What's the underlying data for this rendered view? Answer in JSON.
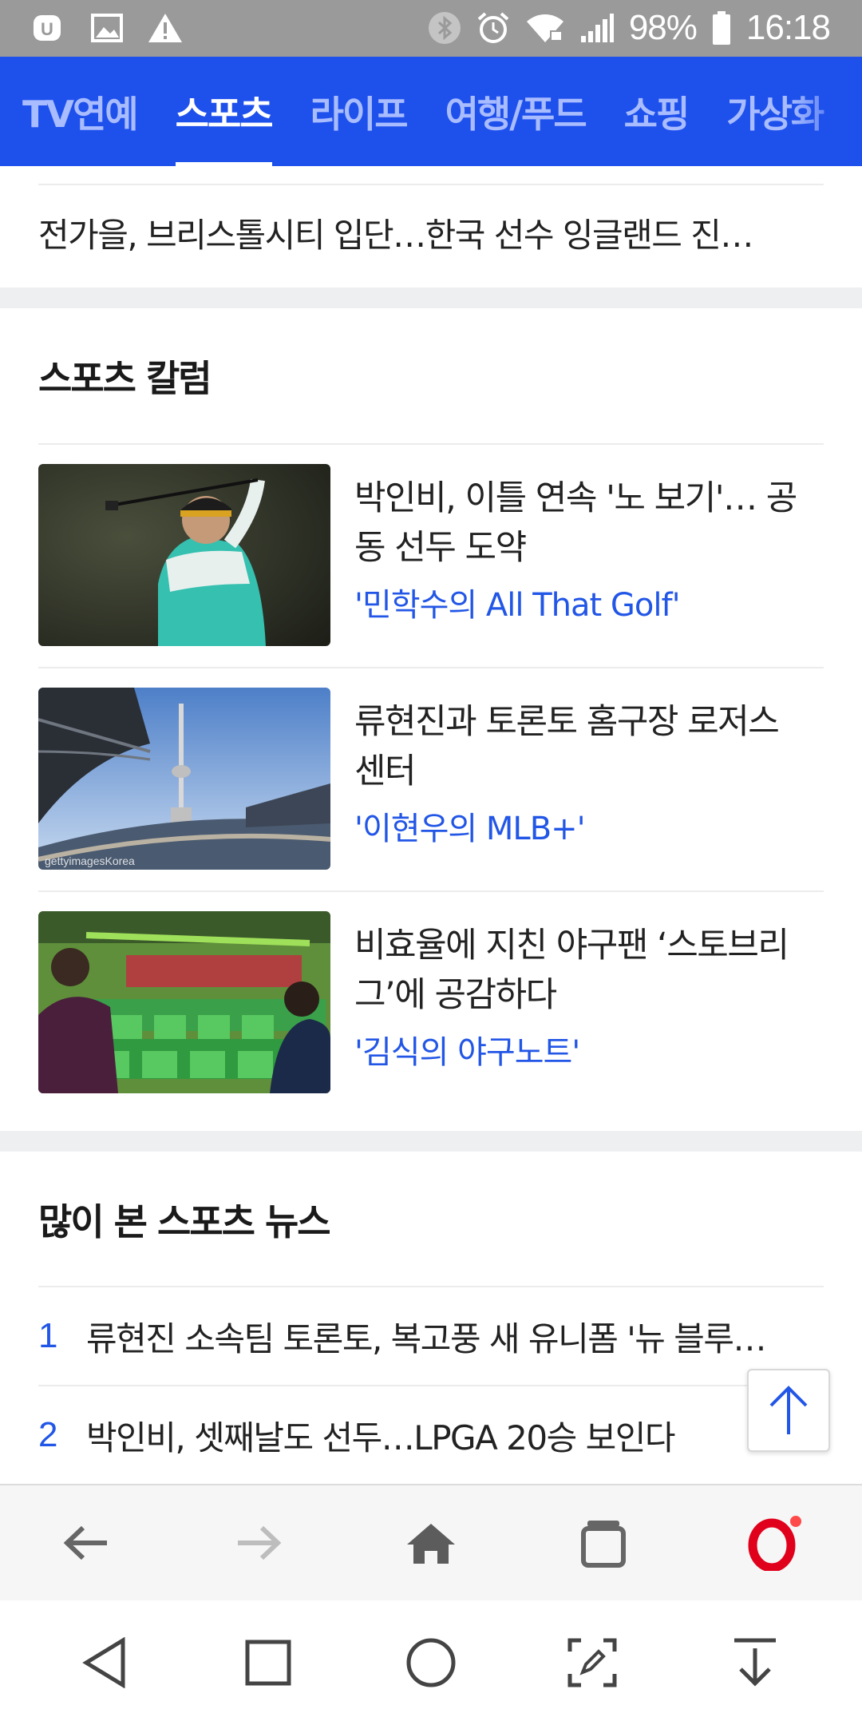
{
  "status_bar": {
    "battery": "98%",
    "time": "16:18",
    "icons": [
      "notification-app-icon",
      "image-icon",
      "warning-icon",
      "bluetooth-icon",
      "alarm-icon",
      "wifi-icon",
      "signal-icon",
      "battery-icon"
    ]
  },
  "top_nav": {
    "tabs": [
      "TV연예",
      "스포츠",
      "라이프",
      "여행/푸드",
      "쇼핑",
      "가상화"
    ],
    "active_tab": "스포츠"
  },
  "headline": "전가을, 브리스톨시티 입단…한국 선수 잉글랜드 진…",
  "columns": {
    "title": "스포츠 칼럼",
    "items": [
      {
        "title": "박인비, 이틀 연속 '노 보기'… 공동 선두 도약",
        "author": "'민학수의 All That Golf'"
      },
      {
        "title": "류현진과 토론토 홈구장 로저스센터",
        "author": "'이현우의 MLB+'"
      },
      {
        "title": "비효율에 지친 야구팬 ‘스토브리그’에 공감하다",
        "author": "'김식의 야구노트'"
      }
    ],
    "thumb_watermark": "gettyimagesKorea"
  },
  "most_viewed": {
    "title": "많이 본 스포츠 뉴스",
    "items": [
      {
        "rank": "1",
        "text": "류현진 소속팀 토론토, 복고풍 새 유니폼 '뉴 블루…"
      },
      {
        "rank": "2",
        "text": "박인비, 셋째날도 선두…LPGA 20승 보인다"
      }
    ]
  },
  "browser_toolbar": [
    "back-arrow-icon",
    "forward-arrow-icon",
    "home-icon",
    "tabs-icon",
    "opera-menu-icon"
  ],
  "system_nav": [
    "back-triangle-icon",
    "recents-square-icon",
    "home-circle-icon",
    "screenshot-edit-icon",
    "notification-pull-icon"
  ],
  "colors": {
    "nav_blue": "#1e50ec",
    "link_blue": "#2256e6",
    "opera_red": "#e0001b"
  }
}
